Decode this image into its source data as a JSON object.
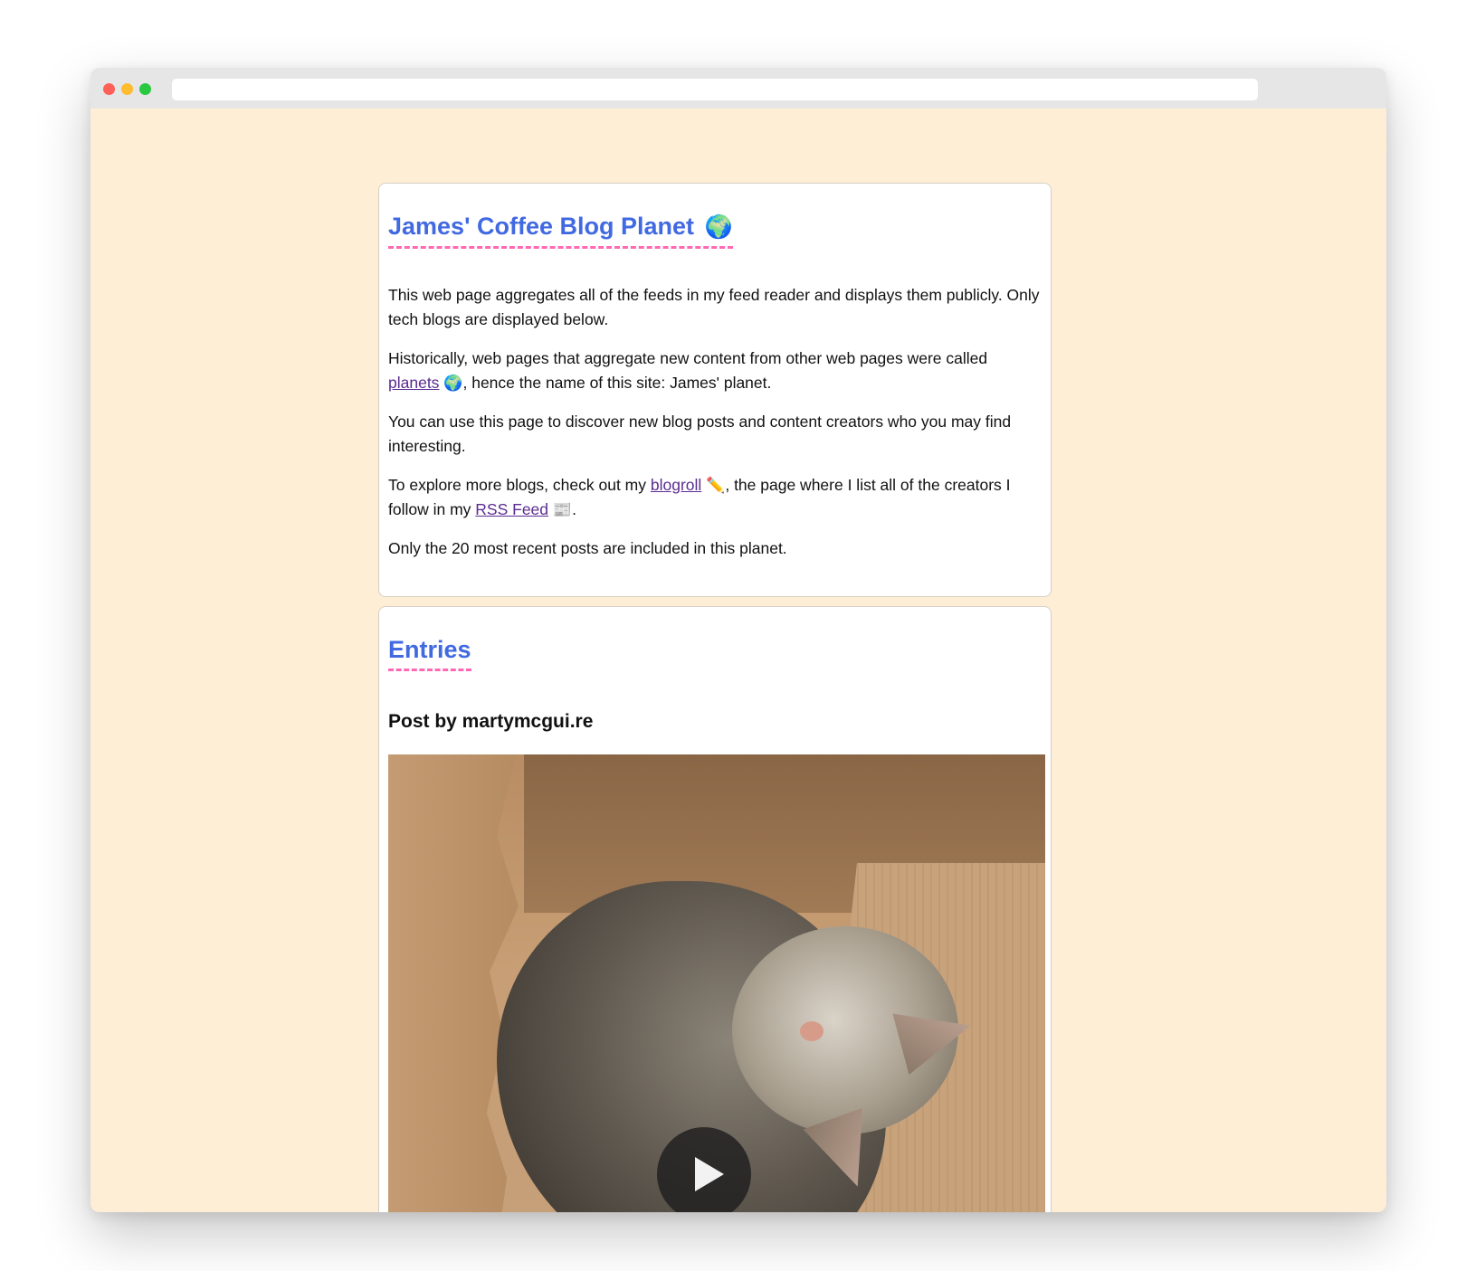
{
  "browser": {
    "url": ""
  },
  "intro": {
    "title": "James' Coffee Blog Planet",
    "title_emoji": "🌍",
    "p1": "This web page aggregates all of the feeds in my feed reader and displays them publicly. Only tech blogs are displayed below.",
    "p2_before": "Historically, web pages that aggregate new content from other web pages were called ",
    "p2_link": "planets",
    "p2_emoji": "🌍",
    "p2_after": ", hence the name of this site: James' planet.",
    "p3": "You can use this page to discover new blog posts and content creators who you may find interesting.",
    "p4_before": "To explore more blogs, check out my ",
    "p4_link1": "blogroll",
    "p4_emoji1": "✏️",
    "p4_middle": ", the page where I list all of the creators I follow in my ",
    "p4_link2": "RSS Feed",
    "p4_emoji2": "📰",
    "p4_after": ".",
    "p5": "Only the 20 most recent posts are included in this planet."
  },
  "entries": {
    "title": "Entries",
    "items": [
      {
        "post_title": "Post by martymcgui.re",
        "media": "video"
      }
    ]
  },
  "colors": {
    "heading": "#4169e1",
    "heading_underline": "#ff69b4",
    "page_background": "#feeed5",
    "link": "#5b2c91"
  },
  "icons": [
    "globe-icon",
    "pencil-icon",
    "newspaper-icon",
    "play-icon"
  ]
}
